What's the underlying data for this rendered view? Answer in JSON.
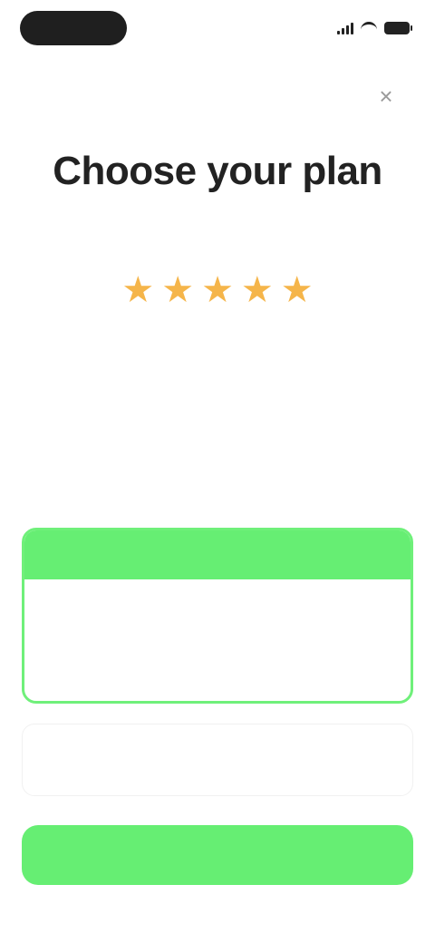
{
  "status_bar": {
    "time": "",
    "icons": [
      "signal-icon",
      "wifi-icon",
      "battery-icon"
    ]
  },
  "header": {
    "close_icon": "close-icon",
    "close_glyph": "×"
  },
  "title": "Choose your plan",
  "rating": {
    "stars": 5,
    "star_glyph": "★",
    "star_color": "#f5b54a",
    "review_text": ""
  },
  "plans": {
    "selected": {
      "badge": "",
      "name": "",
      "price": "",
      "description": ""
    },
    "secondary": {
      "name": "",
      "price": ""
    }
  },
  "cta": {
    "label": ""
  },
  "colors": {
    "accent": "#66ee73",
    "accent_text": "#1a6b22",
    "star": "#f5b54a"
  }
}
